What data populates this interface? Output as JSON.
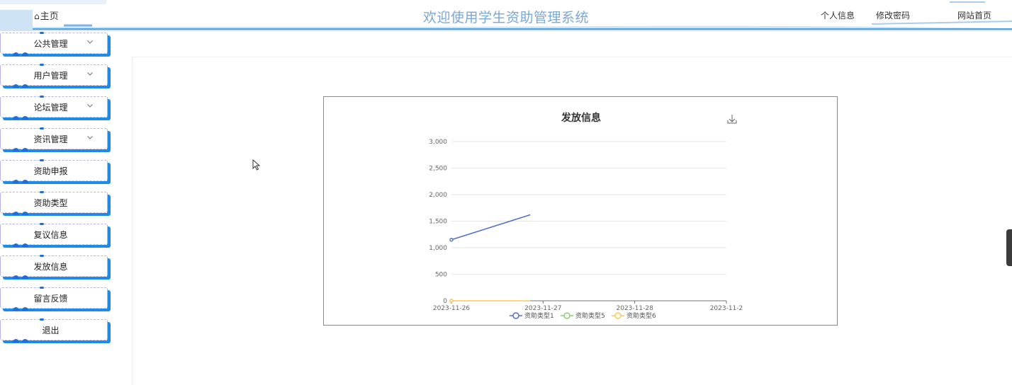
{
  "header": {
    "home_label": "主页",
    "title": "欢迎使用学生资助管理系统",
    "nav": [
      "个人信息",
      "修改密码",
      "网站首页"
    ]
  },
  "sidebar": {
    "items": [
      {
        "label": "公共管理",
        "expandable": true
      },
      {
        "label": "用户管理",
        "expandable": true
      },
      {
        "label": "论坛管理",
        "expandable": true
      },
      {
        "label": "资讯管理",
        "expandable": true
      },
      {
        "label": "资助申报",
        "expandable": false
      },
      {
        "label": "资助类型",
        "expandable": false
      },
      {
        "label": "复议信息",
        "expandable": false
      },
      {
        "label": "发放信息",
        "expandable": false
      },
      {
        "label": "留言反馈",
        "expandable": false
      },
      {
        "label": "退出",
        "expandable": false
      }
    ]
  },
  "colors": {
    "accent": "#1e8be8",
    "title": "#7aa7d6",
    "series": [
      "#5470c6",
      "#91cc75",
      "#fac858"
    ]
  },
  "chart_data": {
    "type": "line",
    "title": "发放信息",
    "x": [
      "2023-11-26",
      "2023-11-27",
      "2023-11-28",
      "2023-11-2"
    ],
    "ylim": [
      0,
      3000
    ],
    "yticks": [
      0,
      500,
      1000,
      1500,
      2000,
      2500,
      3000
    ],
    "ytick_labels": [
      "0",
      "500",
      "1,000",
      "1,500",
      "2,000",
      "2,500",
      "3,000"
    ],
    "grid": true,
    "legend_position": "bottom",
    "series": [
      {
        "name": "资助类型1",
        "values": [
          1150,
          1620
        ],
        "x_index": [
          0,
          0.86
        ]
      },
      {
        "name": "资助类型5",
        "values": [
          0
        ],
        "x_index": [
          0
        ]
      },
      {
        "name": "资助类型6",
        "values": [
          0,
          0
        ],
        "x_index": [
          0,
          0.86
        ]
      }
    ],
    "toolbox": "download-icon"
  }
}
